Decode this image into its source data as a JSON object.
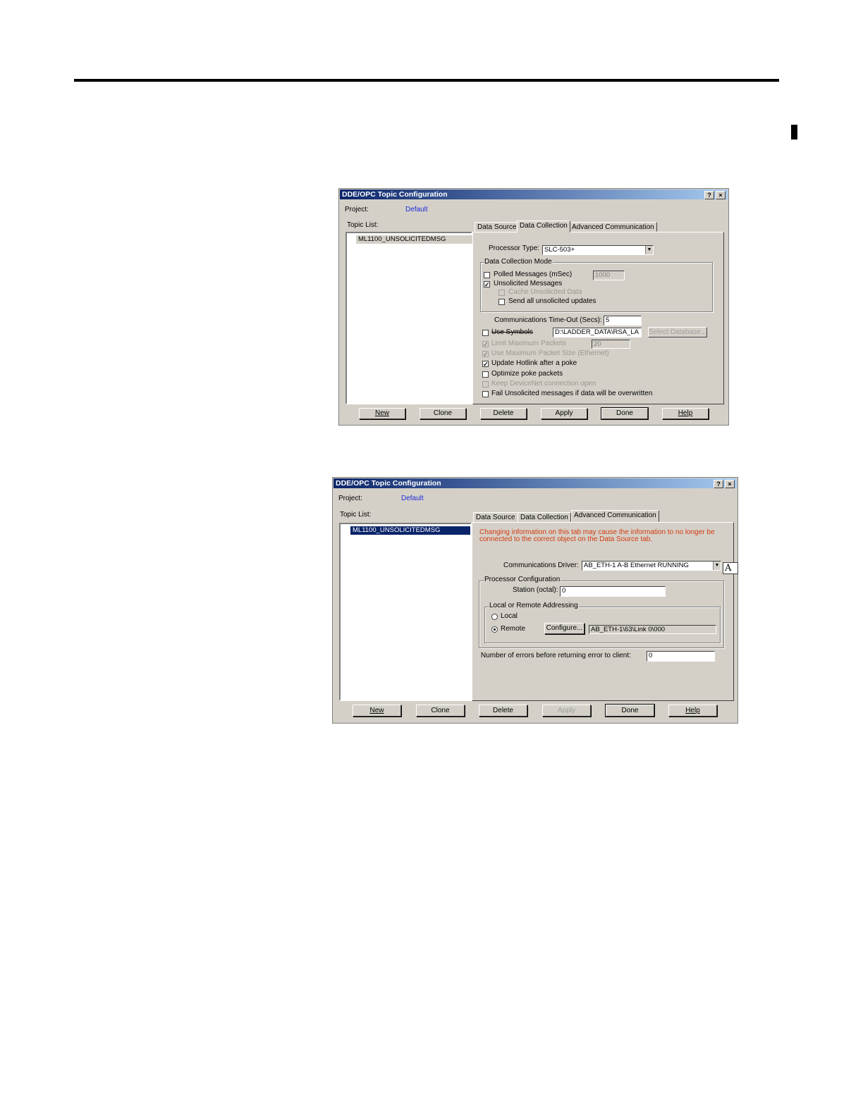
{
  "dialog1": {
    "title": "DDE/OPC Topic Configuration",
    "help_btn": "?",
    "close_btn": "×",
    "project_label": "Project:",
    "project_value": "Default",
    "topic_list_label": "Topic List:",
    "topic_items": [
      "ML1100_UNSOLICITEDMSG"
    ],
    "tabs": [
      "Data Source",
      "Data Collection",
      "Advanced Communication"
    ],
    "active_tab": "Data Collection",
    "processor_type_label": "Processor Type:",
    "processor_type_value": "SLC-503+",
    "data_collection_mode_label": "Data Collection Mode",
    "polled_label": "Polled Messages (mSec)",
    "polled_value": "1000",
    "unsolicited_label": "Unsolicited Messages",
    "cache_label": "Cache Unsolicited Data",
    "send_all_label": "Send all unsolicited updates",
    "timeout_label": "Communications Time-Out (Secs):",
    "timeout_value": "5",
    "use_symbols_label": "Use Symbols",
    "symbols_path": "D:\\LADDER_DATA\\RSA_LA",
    "select_db_label": "Select Database...",
    "limit_packets_label": "Limit Maximum Packets",
    "limit_packets_value": "20",
    "max_packet_label": "Use Maximum Packet Size (Ethernet)",
    "update_hotlink_label": "Update Hotlink after a poke",
    "optimize_poke_label": "Optimize poke packets",
    "keep_devicenet_label": "Keep DeviceNet connection open",
    "fail_unsolicited_label": "Fail Unsolicited messages if data will be overwritten",
    "buttons": [
      "New",
      "Clone",
      "Delete",
      "Apply",
      "Done",
      "Help"
    ]
  },
  "dialog2": {
    "title": "DDE/OPC Topic Configuration",
    "help_btn": "?",
    "close_btn": "×",
    "project_label": "Project:",
    "project_value": "Default",
    "topic_list_label": "Topic List:",
    "topic_items": [
      "ML1100_UNSOLICITEDMSG"
    ],
    "tabs": [
      "Data Source",
      "Data Collection",
      "Advanced Communication"
    ],
    "active_tab": "Advanced Communication",
    "warning_line1": "Changing information on this tab may cause the information to no longer be",
    "warning_line2": "connected to the correct object on the Data Source tab.",
    "driver_label": "Communications Driver:",
    "driver_value": "AB_ETH-1  A-B Ethernet  RUNNING",
    "processor_config_label": "Processor Configuration",
    "station_label": "Station (octal):",
    "station_value": "0",
    "addressing_label": "Local or Remote Addressing",
    "local_label": "Local",
    "remote_label": "Remote",
    "configure_label": "Configure...",
    "remote_path": "AB_ETH-1\\63\\Link 0\\000",
    "errors_label": "Number of errors before returning error to client:",
    "errors_value": "0",
    "buttons": [
      "New",
      "Clone",
      "Delete",
      "Apply",
      "Done",
      "Help"
    ]
  },
  "ime_indicator": "A"
}
